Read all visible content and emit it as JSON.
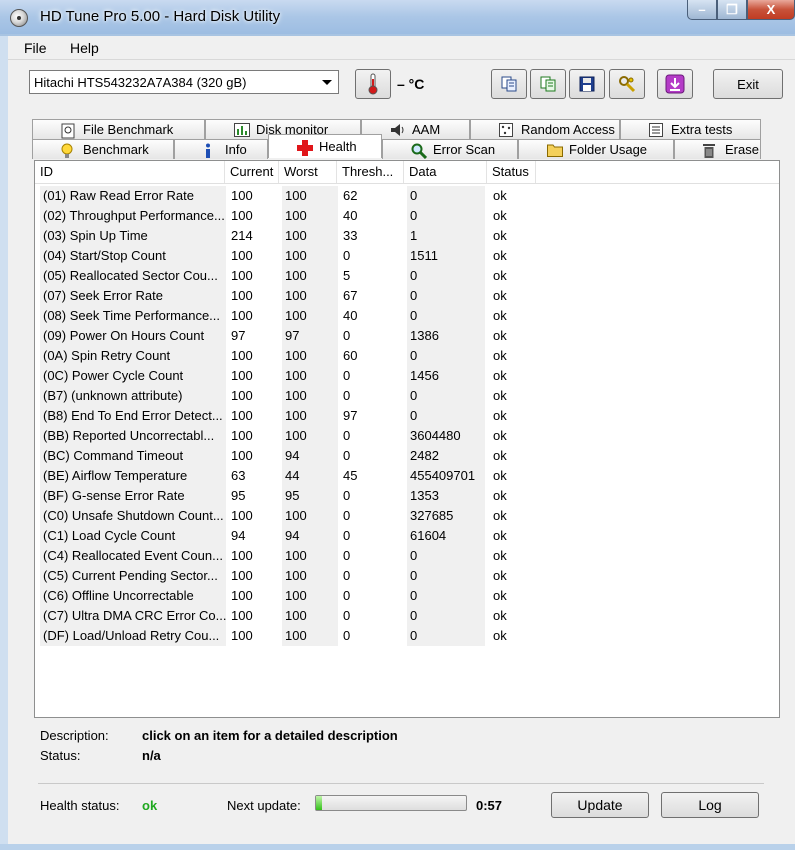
{
  "window": {
    "title": "HD Tune Pro 5.00 - Hard Disk Utility",
    "min_label": "–",
    "max_label": "❐",
    "close_label": "X"
  },
  "menu": {
    "file": "File",
    "help": "Help"
  },
  "toolbar": {
    "drive": "Hitachi HTS543232A7A384  (320 gB)",
    "temperature": "– °C",
    "exit_label": "Exit"
  },
  "tabs": {
    "top": [
      "File Benchmark",
      "Disk monitor",
      "AAM",
      "Random Access",
      "Extra tests"
    ],
    "bottom": [
      "Benchmark",
      "Info",
      "Health",
      "Error Scan",
      "Folder Usage",
      "Erase"
    ],
    "active": "Health"
  },
  "table": {
    "headers": [
      "ID",
      "Current",
      "Worst",
      "Thresh...",
      "Data",
      "Status"
    ],
    "rows": [
      [
        "(01) Raw Read Error Rate",
        "100",
        "100",
        "62",
        "0",
        "ok"
      ],
      [
        "(02) Throughput Performance...",
        "100",
        "100",
        "40",
        "0",
        "ok"
      ],
      [
        "(03) Spin Up Time",
        "214",
        "100",
        "33",
        "1",
        "ok"
      ],
      [
        "(04) Start/Stop Count",
        "100",
        "100",
        "0",
        "1511",
        "ok"
      ],
      [
        "(05) Reallocated Sector Cou...",
        "100",
        "100",
        "5",
        "0",
        "ok"
      ],
      [
        "(07) Seek Error Rate",
        "100",
        "100",
        "67",
        "0",
        "ok"
      ],
      [
        "(08) Seek Time Performance...",
        "100",
        "100",
        "40",
        "0",
        "ok"
      ],
      [
        "(09) Power On Hours Count",
        "97",
        "97",
        "0",
        "1386",
        "ok"
      ],
      [
        "(0A) Spin Retry Count",
        "100",
        "100",
        "60",
        "0",
        "ok"
      ],
      [
        "(0C) Power Cycle Count",
        "100",
        "100",
        "0",
        "1456",
        "ok"
      ],
      [
        "(B7) (unknown attribute)",
        "100",
        "100",
        "0",
        "0",
        "ok"
      ],
      [
        "(B8) End To End Error Detect...",
        "100",
        "100",
        "97",
        "0",
        "ok"
      ],
      [
        "(BB) Reported Uncorrectabl...",
        "100",
        "100",
        "0",
        "3604480",
        "ok"
      ],
      [
        "(BC) Command Timeout",
        "100",
        "94",
        "0",
        "2482",
        "ok"
      ],
      [
        "(BE) Airflow Temperature",
        "63",
        "44",
        "45",
        "455409701",
        "ok"
      ],
      [
        "(BF) G-sense Error Rate",
        "95",
        "95",
        "0",
        "1353",
        "ok"
      ],
      [
        "(C0) Unsafe Shutdown Count...",
        "100",
        "100",
        "0",
        "327685",
        "ok"
      ],
      [
        "(C1) Load Cycle Count",
        "94",
        "94",
        "0",
        "61604",
        "ok"
      ],
      [
        "(C4) Reallocated Event Coun...",
        "100",
        "100",
        "0",
        "0",
        "ok"
      ],
      [
        "(C5) Current Pending Sector...",
        "100",
        "100",
        "0",
        "0",
        "ok"
      ],
      [
        "(C6) Offline Uncorrectable",
        "100",
        "100",
        "0",
        "0",
        "ok"
      ],
      [
        "(C7) Ultra DMA CRC Error Co...",
        "100",
        "100",
        "0",
        "0",
        "ok"
      ],
      [
        "(DF) Load/Unload Retry Cou...",
        "100",
        "100",
        "0",
        "0",
        "ok"
      ]
    ]
  },
  "details": {
    "description_label": "Description:",
    "description_value": "click on an item for a detailed description",
    "status_label": "Status:",
    "status_value": "n/a"
  },
  "footer": {
    "health_label": "Health status:",
    "health_value": "ok",
    "health_color": "#1fa81f",
    "next_update_label": "Next update:",
    "progress_fraction": 0.04,
    "countdown": "0:57",
    "update_label": "Update",
    "log_label": "Log"
  }
}
